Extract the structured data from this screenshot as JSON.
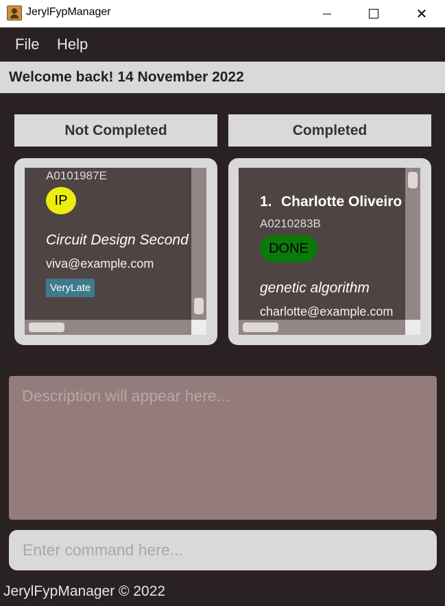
{
  "window": {
    "title": "JerylFypManager",
    "close_glyph": "✕",
    "icons": [
      "app-icon",
      "minimize-icon",
      "maximize-icon",
      "close-icon"
    ]
  },
  "menu": {
    "file_label": "File",
    "help_label": "Help"
  },
  "welcome": {
    "text": "Welcome back! 14 November 2022"
  },
  "lists": {
    "not_completed": {
      "header": "Not Completed",
      "card": {
        "student_id": "A0101987E",
        "status": "IP",
        "project": "Circuit Design Second",
        "email": "viva@example.com",
        "tag": "VeryLate"
      }
    },
    "completed": {
      "header": "Completed",
      "card": {
        "index": "1.",
        "name": "Charlotte Oliveiro",
        "student_id": "A0210283B",
        "status": "DONE",
        "project": "genetic algorithm",
        "email": "charlotte@example.com"
      }
    }
  },
  "description": {
    "placeholder": "Description will appear here..."
  },
  "command": {
    "placeholder": "Enter command here..."
  },
  "footer": {
    "text": "JerylFypManager © 2022"
  },
  "colors": {
    "background": "#2a2222",
    "panel": "#d9d9d9",
    "card": "#4f4444",
    "status_ip": "#ecec10",
    "status_done": "#0b7a0b",
    "tag": "#3f7a8c",
    "description_box": "#957c7c"
  }
}
